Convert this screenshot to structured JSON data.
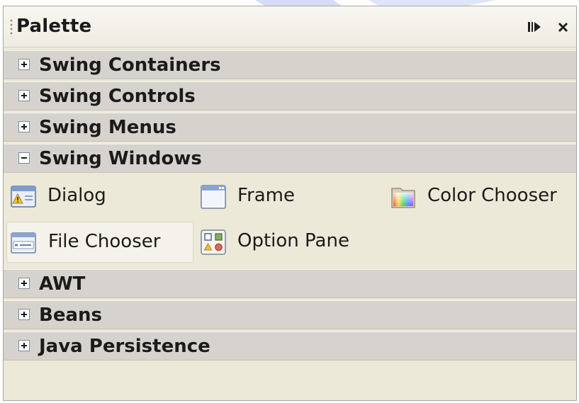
{
  "palette": {
    "title": "Palette",
    "icons": {
      "minimize": "minimize-icon",
      "close": "close-icon"
    },
    "categories_before": [
      {
        "label": "Swing Containers",
        "expanded": false
      },
      {
        "label": "Swing Controls",
        "expanded": false
      },
      {
        "label": "Swing Menus",
        "expanded": false
      },
      {
        "label": "Swing Windows",
        "expanded": true
      }
    ],
    "items": [
      {
        "label": "Dialog",
        "icon": "dialog-icon",
        "selected": false
      },
      {
        "label": "Frame",
        "icon": "frame-icon",
        "selected": false
      },
      {
        "label": "Color Chooser",
        "icon": "color-chooser-icon",
        "selected": false
      },
      {
        "label": "File Chooser",
        "icon": "file-chooser-icon",
        "selected": true
      },
      {
        "label": "Option Pane",
        "icon": "option-pane-icon",
        "selected": false
      }
    ],
    "categories_after": [
      {
        "label": "AWT",
        "expanded": false
      },
      {
        "label": "Beans",
        "expanded": false
      },
      {
        "label": "Java Persistence",
        "expanded": false
      }
    ]
  },
  "colors": {
    "panel_background": "#ece9d8",
    "category_background": "#d6d3ce",
    "selected_item_background": "#f4f2ea"
  }
}
